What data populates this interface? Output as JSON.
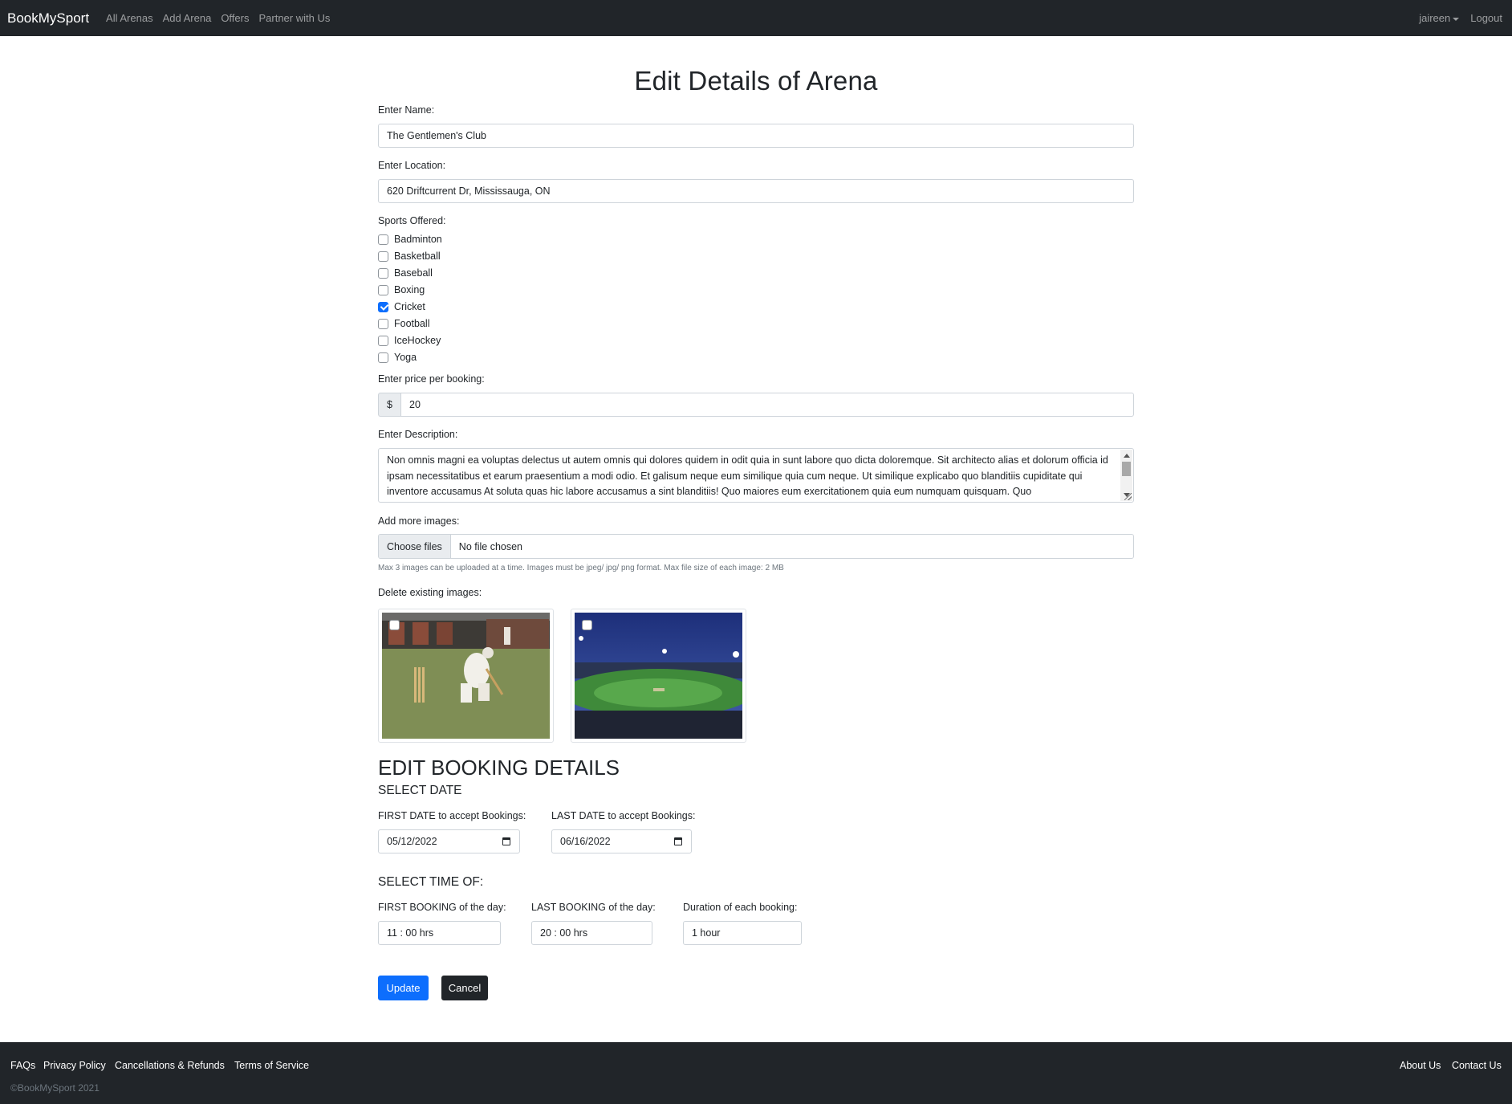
{
  "navbar": {
    "brand": "BookMySport",
    "links": [
      "All Arenas",
      "Add Arena",
      "Offers",
      "Partner with Us"
    ],
    "user": "jaireen",
    "logout": "Logout"
  },
  "form": {
    "title": "Edit Details of Arena",
    "name_label": "Enter Name:",
    "name_value": "The Gentlemen's Club",
    "location_label": "Enter Location:",
    "location_value": "620 Driftcurrent Dr, Mississauga, ON",
    "sports_label": "Sports Offered:",
    "sports": [
      {
        "name": "Badminton",
        "checked": false
      },
      {
        "name": "Basketball",
        "checked": false
      },
      {
        "name": "Baseball",
        "checked": false
      },
      {
        "name": "Boxing",
        "checked": false
      },
      {
        "name": "Cricket",
        "checked": true
      },
      {
        "name": "Football",
        "checked": false
      },
      {
        "name": "IceHockey",
        "checked": false
      },
      {
        "name": "Yoga",
        "checked": false
      }
    ],
    "price_label": "Enter price per booking:",
    "currency": "$",
    "price_value": "20",
    "description_label": "Enter Description:",
    "description_value": "Non omnis magni ea voluptas delectus ut autem omnis qui dolores quidem in odit quia in sunt labore quo dicta doloremque. Sit architecto alias et dolorum officia id ipsam necessitatibus et earum praesentium a modi odio. Et galisum neque eum similique quia cum neque. Ut similique explicabo quo blanditiis cupiditate qui inventore accusamus At soluta quas hic labore accusamus a sint blanditiis! Quo maiores eum exercitationem quia eum numquam quisquam. Quo",
    "images_label": "Add more images:",
    "choose_files": "Choose files",
    "no_file": "No file chosen",
    "images_help": "Max 3 images can be uploaded at a time. Images must be jpeg/ jpg/ png format. Max file size of each image: 2 MB",
    "delete_label": "Delete existing images:"
  },
  "booking": {
    "heading": "EDIT BOOKING DETAILS",
    "select_date": "SELECT DATE",
    "first_date_label": "FIRST DATE to accept Bookings:",
    "first_date_value": "05/12/2022",
    "last_date_label": "LAST DATE to accept Bookings:",
    "last_date_value": "06/16/2022",
    "select_time": "SELECT TIME OF:",
    "first_booking_label": "FIRST BOOKING of the day:",
    "first_booking_value": "11 : 00 hrs",
    "last_booking_label": "LAST BOOKING of the day:",
    "last_booking_value": "20 : 00 hrs",
    "duration_label": "Duration of each booking:",
    "duration_value": "1 hour",
    "update": "Update",
    "cancel": "Cancel"
  },
  "footer": {
    "left_links": [
      "FAQs",
      "Privacy Policy",
      "Cancellations & Refunds",
      "Terms of Service"
    ],
    "right_links": [
      "About Us",
      "Contact Us"
    ],
    "copyright": "©BookMySport 2021"
  },
  "colors": {
    "navbar": "#212529",
    "primary": "#0d6efd",
    "dark_button": "#212529"
  }
}
